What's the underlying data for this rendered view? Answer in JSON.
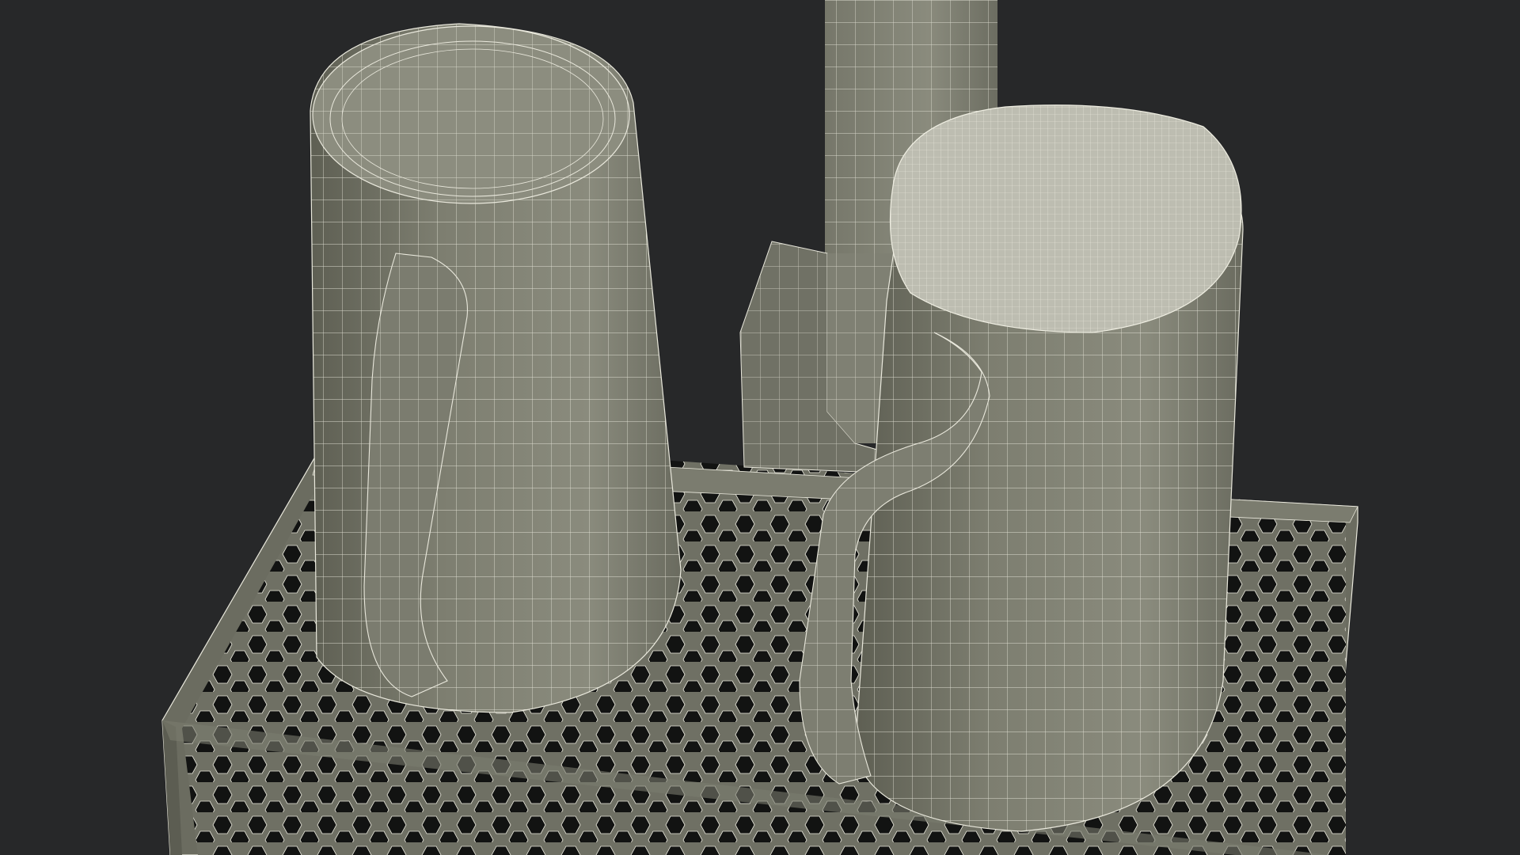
{
  "scene": {
    "colors": {
      "background": "#272829",
      "surface": "#7a7b6d",
      "surface_light": "#8e8f80",
      "surface_dark": "#5e5f53",
      "wire": "#e9e8dc",
      "hole": "#121312"
    },
    "objects": [
      {
        "name": "drip-tray",
        "kind": "honeycomb grate tray"
      },
      {
        "name": "beer-tower",
        "kind": "draft tower column"
      },
      {
        "name": "mug-left",
        "kind": "beer mug"
      },
      {
        "name": "mug-right",
        "kind": "beer mug with foam"
      }
    ],
    "render_style": "wireframe-over-shaded"
  }
}
